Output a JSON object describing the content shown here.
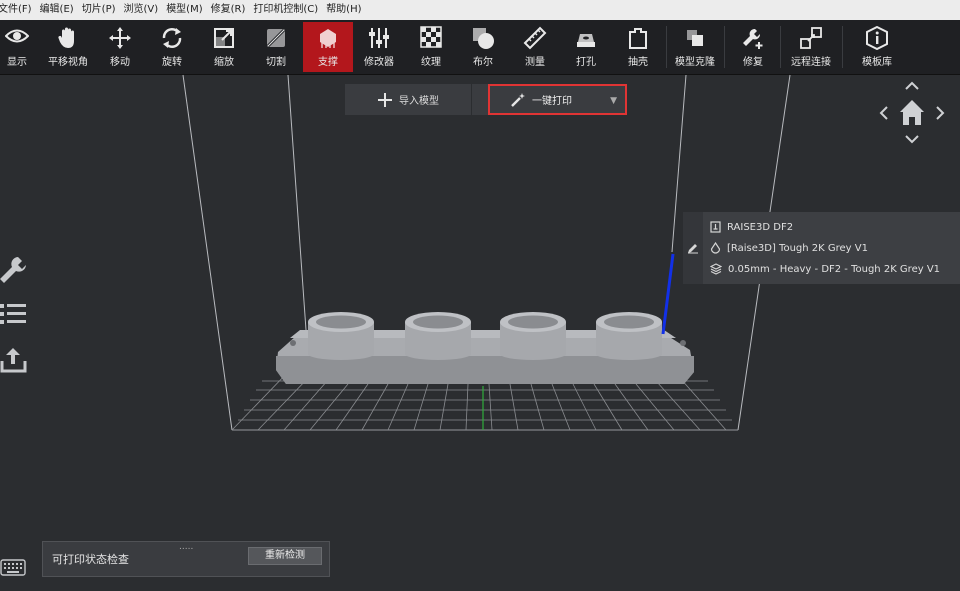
{
  "menu": [
    "文件(F)",
    "编辑(E)",
    "切片(P)",
    "浏览(V)",
    "模型(M)",
    "修复(R)",
    "打印机控制(C)",
    "帮助(H)"
  ],
  "toolbar": {
    "tools": [
      {
        "label": "显示",
        "icon": "eye-icon"
      },
      {
        "label": "平移视角",
        "icon": "hand-icon"
      },
      {
        "label": "移动",
        "icon": "move-arrows-icon"
      },
      {
        "label": "旋转",
        "icon": "rotate-icon"
      },
      {
        "label": "缩放",
        "icon": "scale-icon"
      },
      {
        "label": "切割",
        "icon": "cut-icon"
      },
      {
        "label": "支撑",
        "icon": "support-icon",
        "active": true
      },
      {
        "label": "修改器",
        "icon": "sliders-icon"
      },
      {
        "label": "纹理",
        "icon": "checker-icon"
      },
      {
        "label": "布尔",
        "icon": "boolean-icon"
      },
      {
        "label": "测量",
        "icon": "ruler-icon"
      },
      {
        "label": "打孔",
        "icon": "punch-icon"
      },
      {
        "label": "抽壳",
        "icon": "shell-icon"
      },
      {
        "label": "模型克隆",
        "icon": "clone-icon"
      },
      {
        "label": "修复",
        "icon": "wrench-plus-icon"
      },
      {
        "label": "远程连接",
        "icon": "remote-icon"
      },
      {
        "label": "模板库",
        "icon": "info-icon"
      }
    ]
  },
  "actions": {
    "import_label": "导入模型",
    "one_click_print_label": "一键打印"
  },
  "printer_info": {
    "printer": "RAISE3D DF2",
    "material": "[Raise3D] Tough 2K Grey V1",
    "profile": "0.05mm - Heavy - DF2 - Tough 2K Grey V1"
  },
  "status_panel": {
    "title": "可打印状态检查",
    "handle": ".....",
    "recheck_label": "重新检测"
  },
  "colors": {
    "accent_red": "#b3171c",
    "highlight_border": "#e03434",
    "background": "#2b2d30"
  }
}
